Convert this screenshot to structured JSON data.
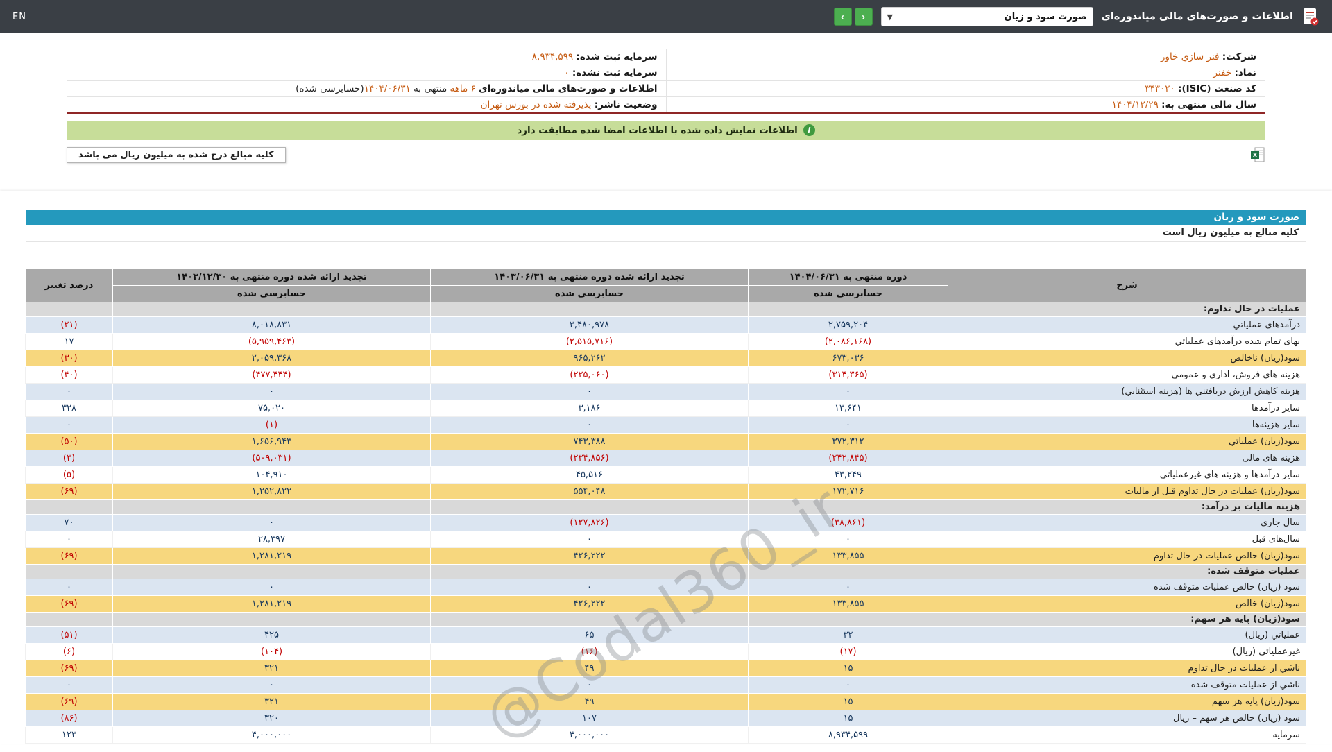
{
  "colors": {
    "topbar": "#3a3f45",
    "title_bar_blue": "#2499bd",
    "row_blue": "#dbe5f1",
    "row_yellow": "#f7d77e",
    "section_gray": "#d9d9d9",
    "header_gray": "#a9a9a9",
    "negative_red": "#c00000",
    "positive_navy": "#17375d",
    "value_orange": "#c55a11",
    "notice_green": "#c7dd99",
    "button_green": "#4caf50",
    "red_rule": "#8f2626"
  },
  "header": {
    "title": "اطلاعات و صورت‌های مالی میاندوره‌ای",
    "statement_select": "صورت سود و زیان",
    "prev_label": "‹",
    "next_label": "›",
    "en_label": "EN"
  },
  "company": {
    "fields_right": [
      {
        "label": "شرکت:",
        "value": "فنر سازي خاور"
      },
      {
        "label": "نماد:",
        "value": "خفنر"
      },
      {
        "label": "کد صنعت (ISIC):",
        "value": "۳۴۳۰۲۰"
      },
      {
        "label": "سال مالی منتهی به:",
        "value": "۱۴۰۴/۱۲/۲۹"
      }
    ],
    "fields_left": [
      {
        "label": "سرمایه ثبت شده:",
        "value": "۸,۹۳۴,۵۹۹"
      },
      {
        "label": "سرمایه ثبت نشده:",
        "value": "۰"
      },
      {
        "label": "اطلاعات و صورت‌های مالی میاندوره‌ای",
        "value_parts": [
          {
            "t": "۶ ماهه ",
            "hl": true
          },
          {
            "t": "منتهی به ",
            "hl": false
          },
          {
            "t": "۱۴۰۴/۰۶/۳۱",
            "hl": true
          },
          {
            "t": "(حسابرسی شده)",
            "hl": false
          }
        ]
      },
      {
        "label": "وضعیت ناشر:",
        "value": "پذیرفته شده در بورس تهران"
      }
    ]
  },
  "notice": "اطلاعات نمایش داده شده با اطلاعات امضا شده مطابقت دارد",
  "unit_note_top": "کلیه مبالغ درج شده به میلیون ریال می باشد",
  "watermark": "@Codal360_ir",
  "table": {
    "title": "صورت سود و زیان",
    "unit_note": "کلیه مبالغ به میلیون ریال است",
    "columns": {
      "desc": "شرح",
      "p1": "دوره منتهی به ۱۴۰۴/۰۶/۳۱",
      "p2": "تجدید ارائه شده دوره منتهی به ۱۴۰۳/۰۶/۳۱",
      "p3": "تجدید ارائه شده دوره منتهی به ۱۴۰۳/۱۲/۳۰",
      "pct": "درصد تغییر",
      "audited": "حسابرسی شده"
    },
    "rows": [
      {
        "type": "section",
        "label": "عملیات در حال تداوم:"
      },
      {
        "type": "data",
        "shade": "blue",
        "label": "درآمدهای عملیاتي",
        "v1": "۲,۷۵۹,۲۰۴",
        "v2": "۳,۴۸۰,۹۷۸",
        "v3": "۸,۰۱۸,۸۳۱",
        "pct": "(۲۱)"
      },
      {
        "type": "data",
        "shade": "white",
        "label": "بهای تمام شده درآمدهای عملیاتي",
        "v1": "(۲,۰۸۶,۱۶۸)",
        "v2": "(۲,۵۱۵,۷۱۶)",
        "v3": "(۵,۹۵۹,۴۶۳)",
        "pct": "۱۷"
      },
      {
        "type": "data",
        "shade": "yellow",
        "label": "سود(زیان) ناخالص",
        "v1": "۶۷۳,۰۳۶",
        "v2": "۹۶۵,۲۶۲",
        "v3": "۲,۰۵۹,۳۶۸",
        "pct": "(۳۰)"
      },
      {
        "type": "data",
        "shade": "white",
        "label": "هزینه های فروش، اداری و عمومی",
        "v1": "(۳۱۴,۳۶۵)",
        "v2": "(۲۲۵,۰۶۰)",
        "v3": "(۴۷۷,۴۴۴)",
        "pct": "(۴۰)"
      },
      {
        "type": "data",
        "shade": "blue",
        "label": "هزینه کاهش ارزش دریافتني ها (هزینه استثنایي)",
        "v1": "۰",
        "v2": "۰",
        "v3": "۰",
        "pct": "۰"
      },
      {
        "type": "data",
        "shade": "white",
        "label": "سایر درآمدها",
        "v1": "۱۳,۶۴۱",
        "v2": "۳,۱۸۶",
        "v3": "۷۵,۰۲۰",
        "pct": "۳۲۸"
      },
      {
        "type": "data",
        "shade": "blue",
        "label": "سایر هزینه‌ها",
        "v1": "۰",
        "v2": "۰",
        "v3": "(۱)",
        "pct": "۰"
      },
      {
        "type": "data",
        "shade": "yellow",
        "label": "سود(زیان) عملیاتي",
        "v1": "۳۷۲,۳۱۲",
        "v2": "۷۴۳,۳۸۸",
        "v3": "۱,۶۵۶,۹۴۳",
        "pct": "(۵۰)"
      },
      {
        "type": "data",
        "shade": "blue",
        "label": "هزینه های مالی",
        "v1": "(۲۴۲,۸۴۵)",
        "v2": "(۲۳۴,۸۵۶)",
        "v3": "(۵۰۹,۰۳۱)",
        "pct": "(۳)"
      },
      {
        "type": "data",
        "shade": "white",
        "label": "سایر درآمدها و هزینه های غیرعملیاتي",
        "v1": "۴۳,۲۴۹",
        "v2": "۴۵,۵۱۶",
        "v3": "۱۰۴,۹۱۰",
        "pct": "(۵)"
      },
      {
        "type": "data",
        "shade": "yellow",
        "label": "سود(زیان) عملیات در حال تداوم قبل از مالیات",
        "v1": "۱۷۲,۷۱۶",
        "v2": "۵۵۴,۰۴۸",
        "v3": "۱,۲۵۲,۸۲۲",
        "pct": "(۶۹)"
      },
      {
        "type": "section",
        "label": "هزینه مالیات بر درآمد:"
      },
      {
        "type": "data",
        "shade": "blue",
        "label": "سال جاری",
        "v1": "(۳۸,۸۶۱)",
        "v2": "(۱۲۷,۸۲۶)",
        "v3": "۰",
        "pct": "۷۰"
      },
      {
        "type": "data",
        "shade": "white",
        "label": "سال‌های قبل",
        "v1": "۰",
        "v2": "۰",
        "v3": "۲۸,۳۹۷",
        "pct": "۰"
      },
      {
        "type": "data",
        "shade": "yellow",
        "label": "سود(زیان) خالص عملیات در حال تداوم",
        "v1": "۱۳۳,۸۵۵",
        "v2": "۴۲۶,۲۲۲",
        "v3": "۱,۲۸۱,۲۱۹",
        "pct": "(۶۹)"
      },
      {
        "type": "section",
        "label": "عملیات متوقف شده:"
      },
      {
        "type": "data",
        "shade": "blue",
        "label": "سود (زیان) خالص عملیات متوقف شده",
        "v1": "۰",
        "v2": "۰",
        "v3": "۰",
        "pct": "۰"
      },
      {
        "type": "data",
        "shade": "yellow",
        "label": "سود(زیان) خالص",
        "v1": "۱۳۳,۸۵۵",
        "v2": "۴۲۶,۲۲۲",
        "v3": "۱,۲۸۱,۲۱۹",
        "pct": "(۶۹)"
      },
      {
        "type": "section",
        "label": "سود(زیان) پایه هر سهم:"
      },
      {
        "type": "data",
        "shade": "blue",
        "label": "عملیاتي (ریال)",
        "v1": "۳۲",
        "v2": "۶۵",
        "v3": "۴۲۵",
        "pct": "(۵۱)"
      },
      {
        "type": "data",
        "shade": "white",
        "label": "غیرعملیاتي (ریال)",
        "v1": "(۱۷)",
        "v2": "(۱۶)",
        "v3": "(۱۰۴)",
        "pct": "(۶)"
      },
      {
        "type": "data",
        "shade": "yellow",
        "label": "ناشي از عملیات در حال تداوم",
        "v1": "۱۵",
        "v2": "۴۹",
        "v3": "۳۲۱",
        "pct": "(۶۹)"
      },
      {
        "type": "data",
        "shade": "blue",
        "label": "ناشي از عملیات متوقف شده",
        "v1": "۰",
        "v2": "۰",
        "v3": "۰",
        "pct": "۰"
      },
      {
        "type": "data",
        "shade": "yellow",
        "label": "سود(زیان) پایه هر سهم",
        "v1": "۱۵",
        "v2": "۴۹",
        "v3": "۳۲۱",
        "pct": "(۶۹)"
      },
      {
        "type": "data",
        "shade": "blue",
        "label": "سود (زیان) خالص هر سهم – ریال",
        "v1": "۱۵",
        "v2": "۱۰۷",
        "v3": "۳۲۰",
        "pct": "(۸۶)"
      },
      {
        "type": "data",
        "shade": "white",
        "label": "سرمایه",
        "v1": "۸,۹۳۴,۵۹۹",
        "v2": "۴,۰۰۰,۰۰۰",
        "v3": "۴,۰۰۰,۰۰۰",
        "pct": "۱۲۳"
      }
    ]
  }
}
